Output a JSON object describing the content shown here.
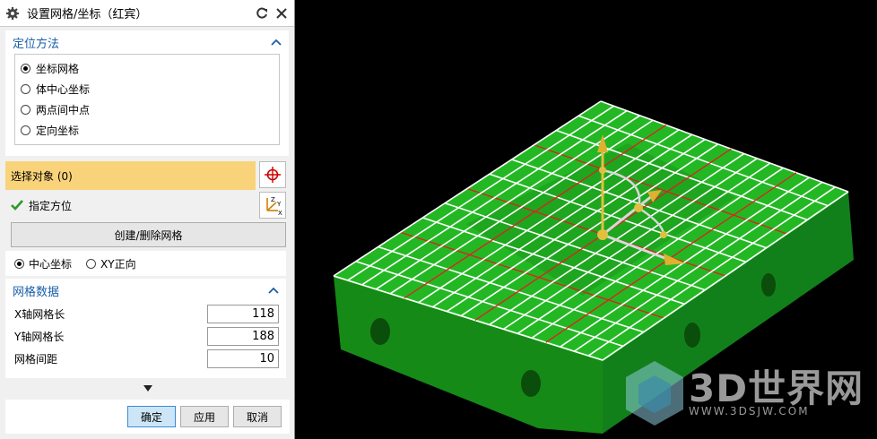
{
  "dialog": {
    "title": "设置网格/坐标（红宾）",
    "positioning": {
      "header": "定位方法",
      "options": [
        "坐标网格",
        "体中心坐标",
        "两点间中点",
        "定向坐标"
      ],
      "selected": 0
    },
    "select_object": "选择对象 (0)",
    "specify_orientation": "指定方位",
    "create_delete_grid": "创建/删除网格",
    "mode": {
      "options": [
        "中心坐标",
        "XY正向"
      ],
      "selected": 0
    },
    "grid_data": {
      "header": "网格数据",
      "fields": [
        {
          "label": "X轴网格长",
          "value": "118"
        },
        {
          "label": "Y轴网格长",
          "value": "188"
        },
        {
          "label": "网格间距",
          "value": "10"
        }
      ]
    },
    "buttons": {
      "ok": "确定",
      "apply": "应用",
      "cancel": "取消"
    }
  },
  "watermark": {
    "brand": "3D世界网",
    "url": "WWW.3DSJW.COM"
  },
  "colors": {
    "accent": "#1a5fa8",
    "selection_bar": "#f9d37a",
    "model_green": "#1ea51e",
    "grid_white": "#ffffff",
    "grid_red": "#e02020"
  },
  "icons": [
    "gear-icon",
    "reset-icon",
    "close-icon",
    "chevron-up-icon",
    "crosshair-icon",
    "checkmark-icon",
    "csys-axis-icon",
    "expand-down-icon"
  ]
}
